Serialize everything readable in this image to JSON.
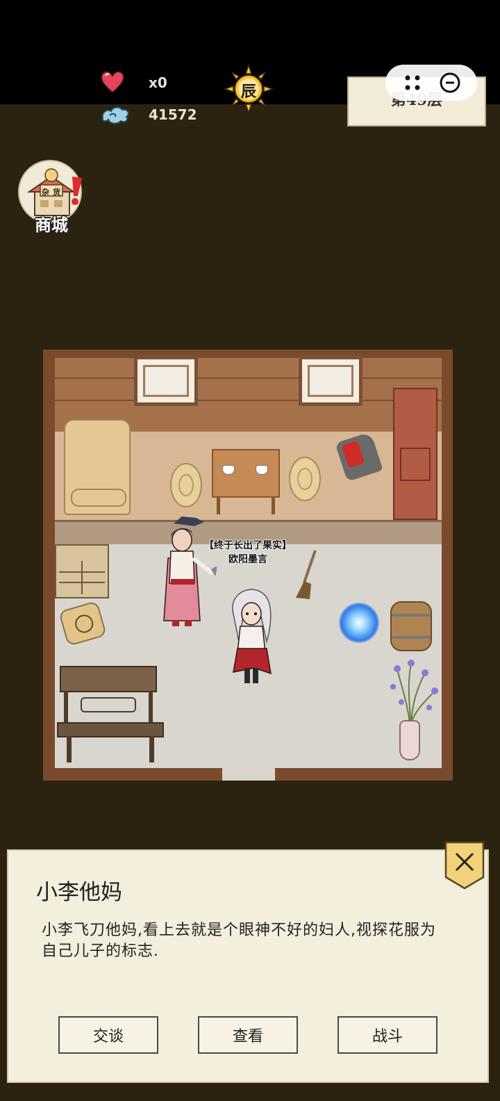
{
  "hud": {
    "hearts_value": "x0",
    "spirit_value": "41572",
    "time_glyph": "辰",
    "floor_label": "第49层"
  },
  "shop": {
    "sign_top": "杂",
    "sign_bottom": "货",
    "label": "商城"
  },
  "room": {
    "npc_title": "【终于长出了果实】",
    "npc_name": "欧阳墨言"
  },
  "dialog": {
    "title": "小李他妈",
    "description": "小李飞刀他妈,看上去就是个眼神不好的妇人,视探花服为自己儿子的标志.",
    "buttons": {
      "talk": "交谈",
      "inspect": "查看",
      "fight": "战斗"
    }
  },
  "colors": {
    "background": "#2b2310",
    "topbar": "#000000",
    "panel": "#f4eedd",
    "heart": "#e8435a",
    "sun": "#f4c431"
  }
}
